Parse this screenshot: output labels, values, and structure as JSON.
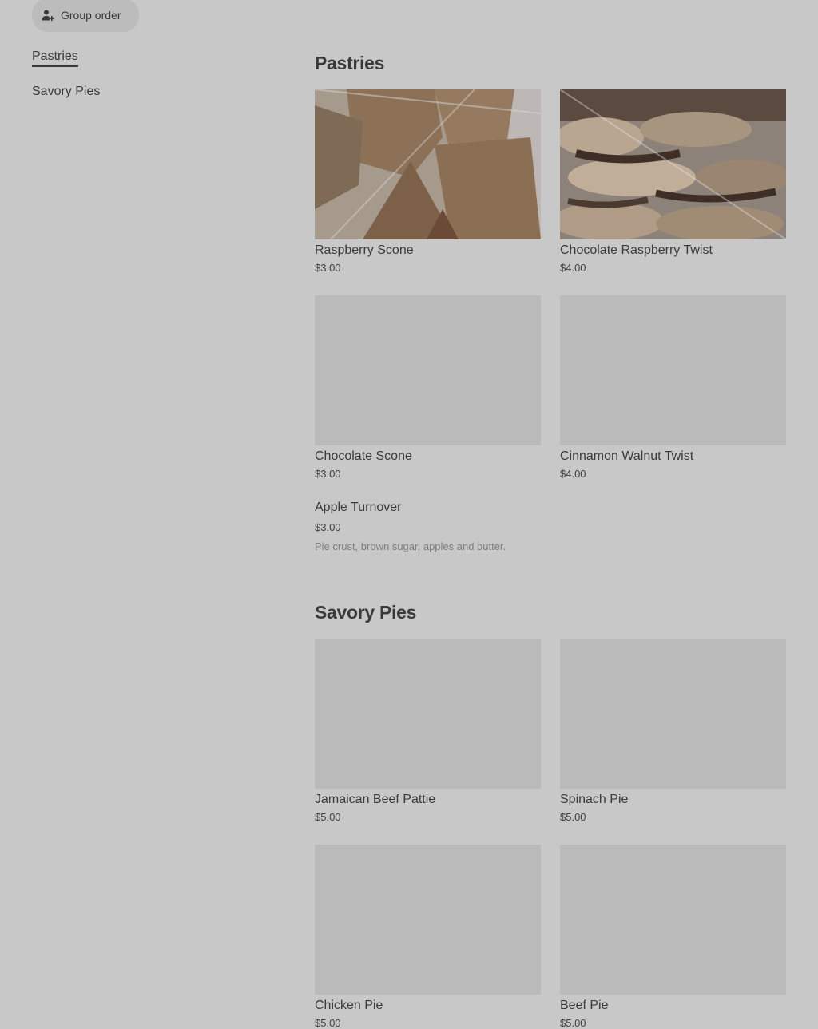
{
  "header": {
    "group_order_label": "Group order"
  },
  "sidebar": {
    "items": [
      {
        "label": "Pastries",
        "active": true
      },
      {
        "label": "Savory Pies",
        "active": false
      }
    ]
  },
  "sections": [
    {
      "title": "Pastries",
      "items": [
        {
          "name": "Raspberry Scone",
          "price": "$3.00"
        },
        {
          "name": "Chocolate Raspberry Twist",
          "price": "$4.00"
        },
        {
          "name": "Chocolate Scone",
          "price": "$3.00"
        },
        {
          "name": "Cinnamon Walnut Twist",
          "price": "$4.00"
        },
        {
          "name": "Apple Turnover",
          "price": "$3.00",
          "description": "Pie crust, brown sugar, apples and butter."
        }
      ]
    },
    {
      "title": "Savory Pies",
      "items": [
        {
          "name": "Jamaican Beef Pattie",
          "price": "$5.00"
        },
        {
          "name": "Spinach Pie",
          "price": "$5.00"
        },
        {
          "name": "Chicken Pie",
          "price": "$5.00"
        },
        {
          "name": "Beef Pie",
          "price": "$5.00"
        }
      ]
    }
  ],
  "icons": {
    "group_order": "person-add-icon"
  }
}
